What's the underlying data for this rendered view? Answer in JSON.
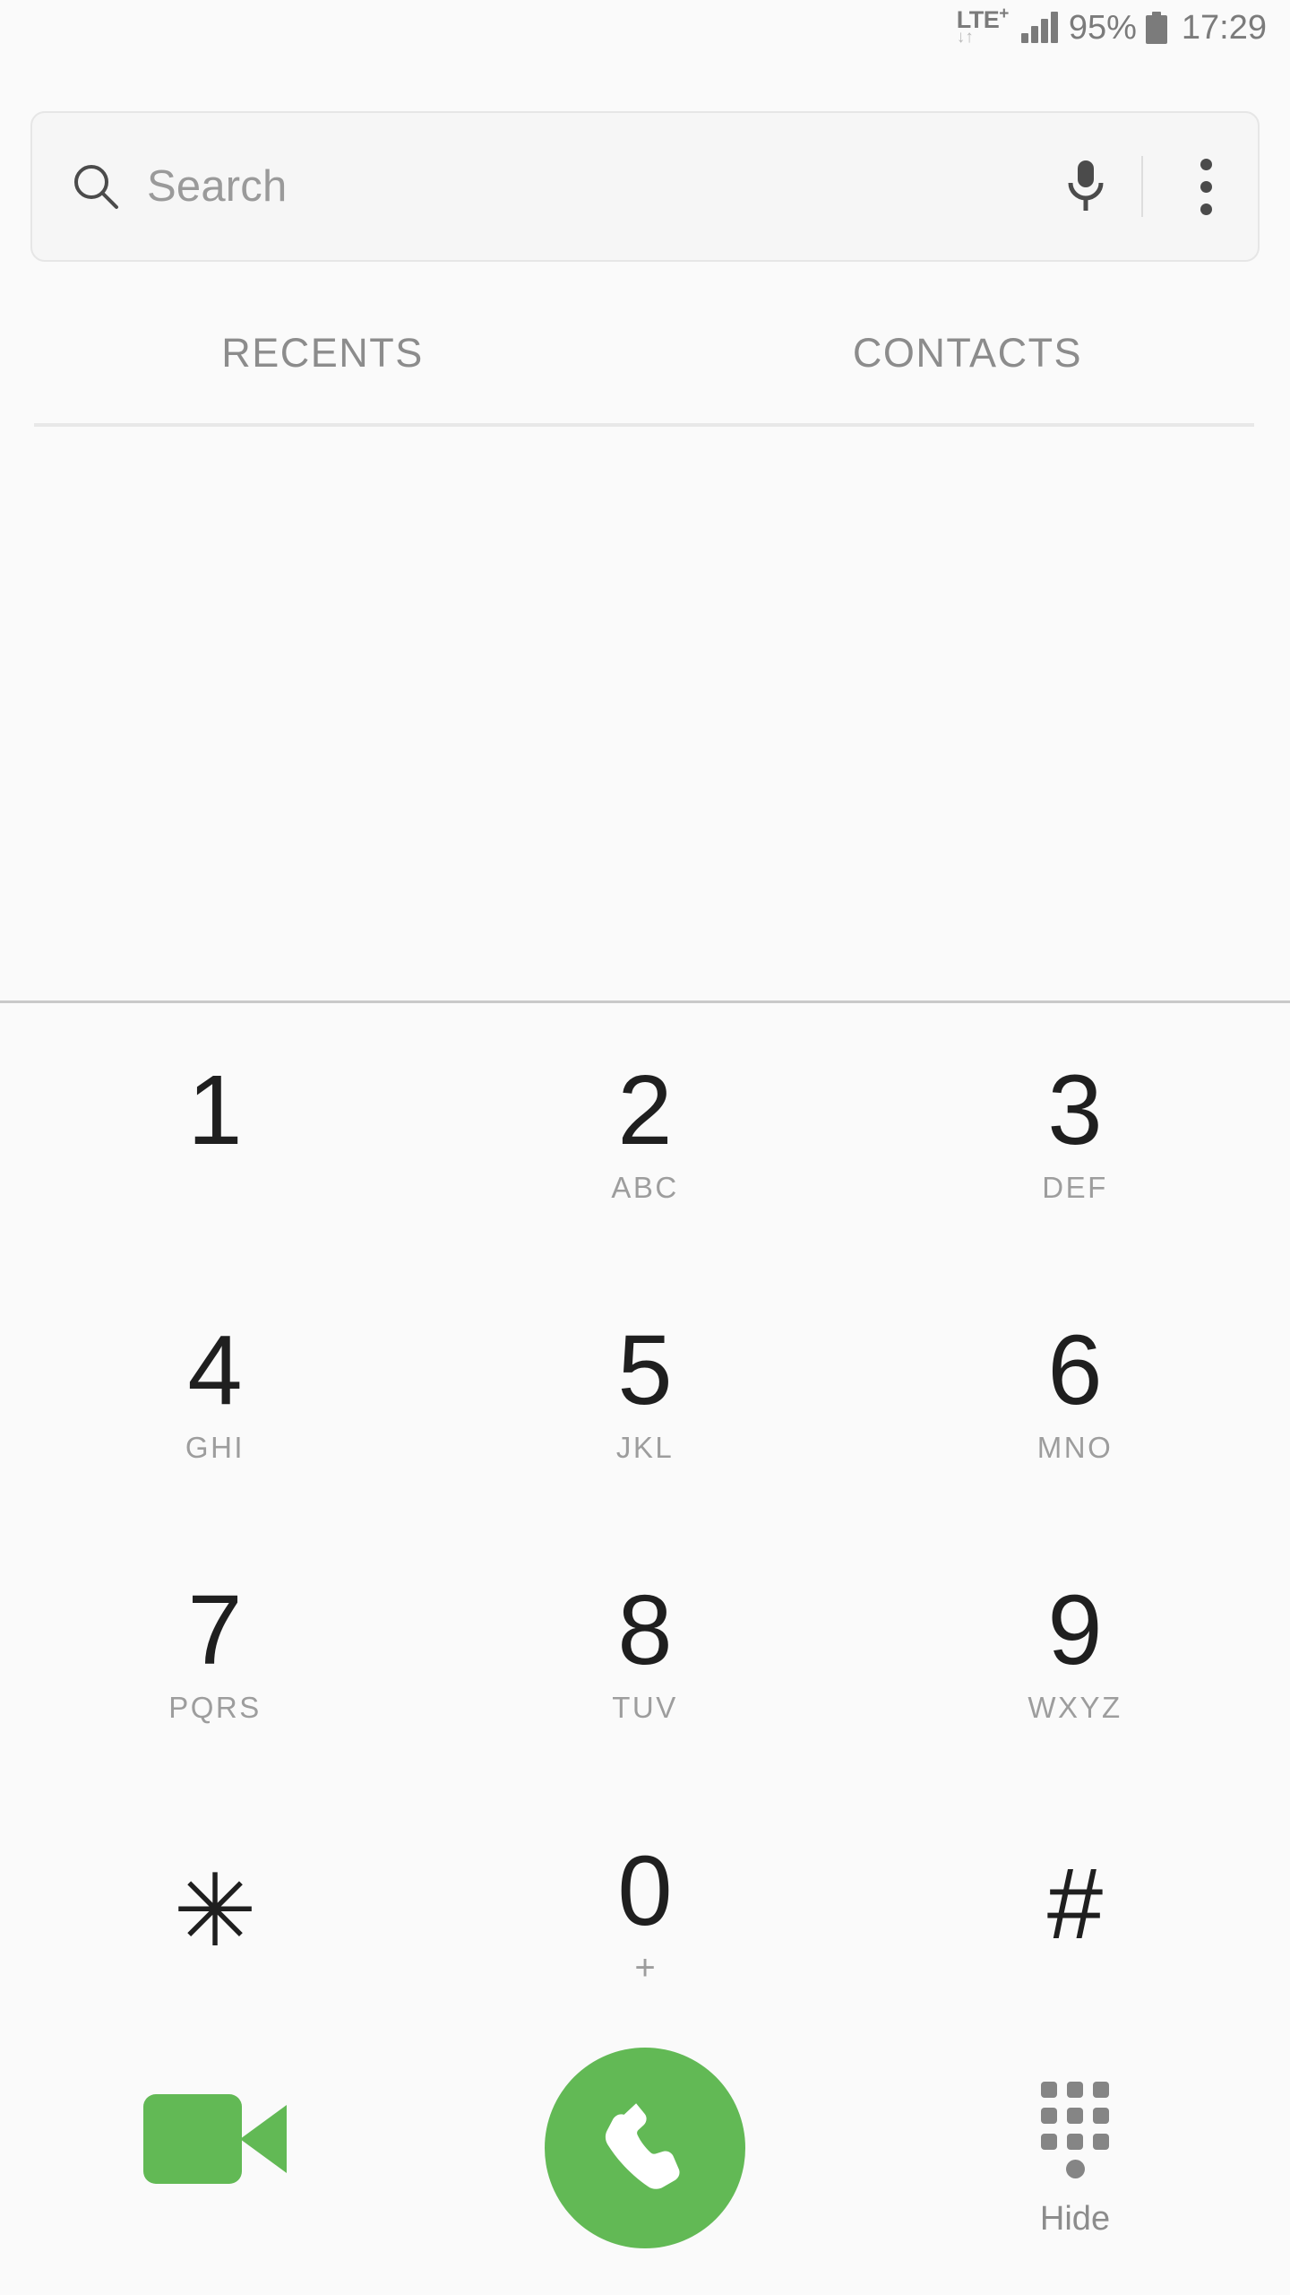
{
  "status_bar": {
    "network_label": "LTE",
    "network_superscript": "+",
    "data_arrows": "↓↑",
    "signal_bars": 4,
    "battery_percent": "95%",
    "battery_icon": "battery-full-icon",
    "clock": "17:29"
  },
  "search": {
    "placeholder": "Search",
    "icon": "search-icon",
    "mic_icon": "microphone-icon",
    "overflow_icon": "more-vertical-icon"
  },
  "tabs": [
    {
      "label": "RECENTS",
      "name": "tab-recents"
    },
    {
      "label": "CONTACTS",
      "name": "tab-contacts"
    }
  ],
  "keypad": {
    "rows": [
      [
        {
          "digit": "1",
          "letters": ""
        },
        {
          "digit": "2",
          "letters": "ABC"
        },
        {
          "digit": "3",
          "letters": "DEF"
        }
      ],
      [
        {
          "digit": "4",
          "letters": "GHI"
        },
        {
          "digit": "5",
          "letters": "JKL"
        },
        {
          "digit": "6",
          "letters": "MNO"
        }
      ],
      [
        {
          "digit": "7",
          "letters": "PQRS"
        },
        {
          "digit": "8",
          "letters": "TUV"
        },
        {
          "digit": "9",
          "letters": "WXYZ"
        }
      ]
    ],
    "last_row": {
      "star": "✳",
      "zero": "0",
      "zero_alt": "+",
      "hash": "#"
    }
  },
  "actions": {
    "video_call": {
      "icon": "video-camera-icon",
      "label": ""
    },
    "call": {
      "icon": "phone-handset-icon",
      "label": ""
    },
    "hide": {
      "icon": "dialpad-icon",
      "label": "Hide"
    }
  },
  "colors": {
    "accent_green": "#62b955",
    "background": "#fafafa",
    "text_primary": "#1f1f1f",
    "text_secondary": "#9d9d9d",
    "status_gray": "#7b7b7b"
  }
}
